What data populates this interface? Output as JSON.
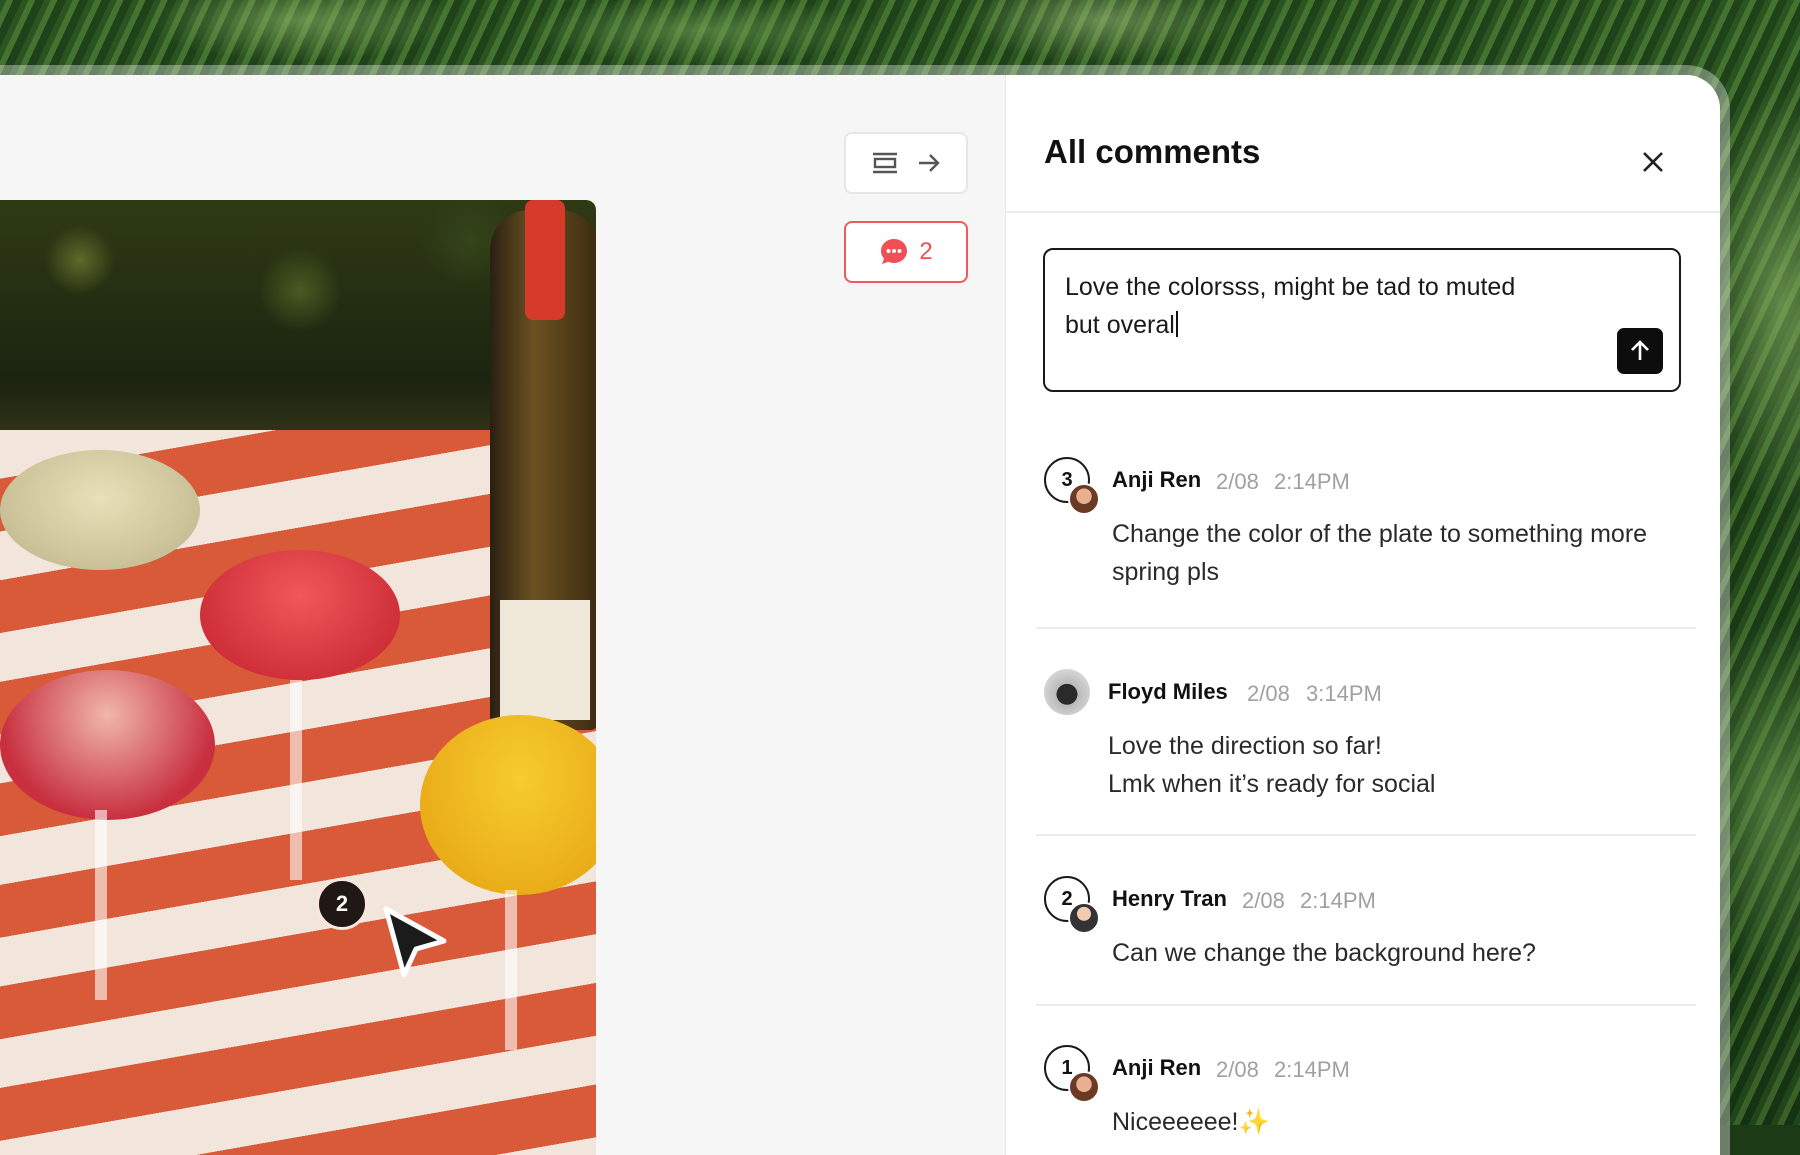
{
  "panel": {
    "title": "All comments",
    "close_icon": "close-icon"
  },
  "toolbar": {
    "layout_icon": "align-center-icon",
    "arrow_icon": "arrow-right-icon",
    "comment_count": "2",
    "comment_icon": "chat-bubble-icon"
  },
  "composer": {
    "line1": "Love the colorsss, might be tad to muted",
    "line2": "but overal",
    "send_icon": "arrow-up-icon"
  },
  "canvas": {
    "pin_number": "2"
  },
  "comments": [
    {
      "number": "3",
      "author": "Anji Ren",
      "date": "2/08",
      "time": "2:14PM",
      "body": "Change the color of the plate to something more spring pls"
    },
    {
      "number": "",
      "author": "Floyd Miles",
      "date": "2/08",
      "time": "3:14PM",
      "body_line1": "Love the direction so far!",
      "body_line2": "Lmk when it’s ready for social"
    },
    {
      "number": "2",
      "author": "Henry Tran",
      "date": "2/08",
      "time": "2:14PM",
      "body": "Can we change the background here?"
    },
    {
      "number": "1",
      "author": "Anji Ren",
      "date": "2/08",
      "time": "2:14PM",
      "body": "Niceeeeee!✨"
    }
  ],
  "colors": {
    "accent_red": "#ef4f55",
    "panel_bg": "#ffffff",
    "canvas_bg": "#f6f6f6"
  }
}
